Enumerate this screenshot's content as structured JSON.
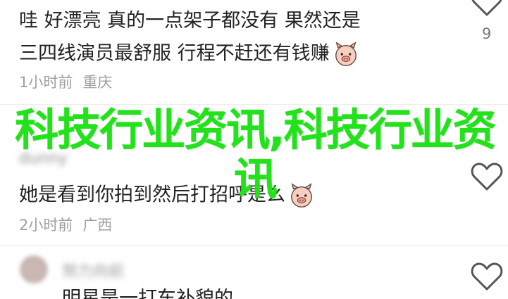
{
  "comment1": {
    "line1": "哇 好漂亮 真的一点架子都没有 果然还是",
    "line2": "三四线演员最舒服 行程不赶还有钱赚",
    "time": "1小时前",
    "location": "重庆",
    "like_count": "9",
    "emoji": "pig-face-emoji"
  },
  "overlay": {
    "title": "科技行业资讯,科技行业资讯"
  },
  "comment2": {
    "username": "dunny",
    "text": "她是看到你拍到然后打招呼是么",
    "time": "2小时前",
    "location": "广西",
    "emoji": "pig-face-emoji"
  },
  "comment3": {
    "username": "努力向前",
    "text": "明星是一打车补貌的"
  },
  "icons": {
    "like": "heart-outline-icon"
  },
  "colors": {
    "overlay_green": "#22e31a",
    "meta_gray": "#a0a0a0",
    "text_dark": "#222222"
  }
}
